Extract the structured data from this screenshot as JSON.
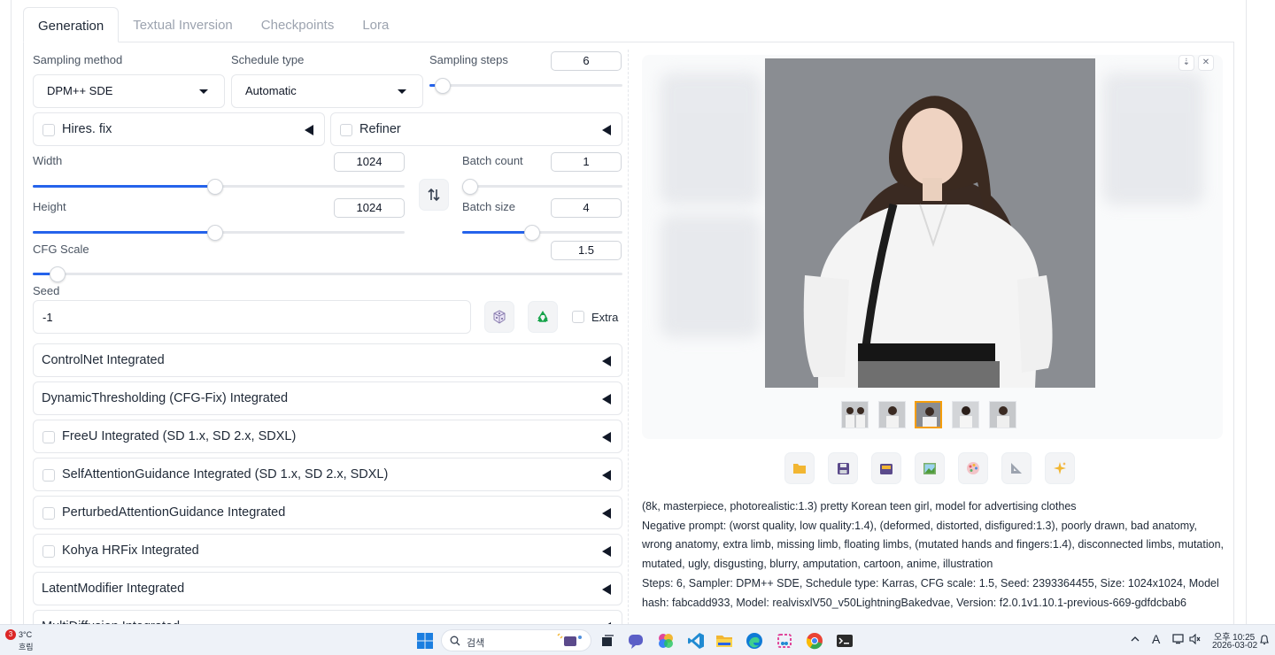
{
  "tabs": [
    "Generation",
    "Textual Inversion",
    "Checkpoints",
    "Lora"
  ],
  "sampling": {
    "method_label": "Sampling method",
    "method_value": "DPM++ SDE",
    "schedule_label": "Schedule type",
    "schedule_value": "Automatic",
    "steps_label": "Sampling steps",
    "steps_value": "6",
    "steps_fraction": 0.03
  },
  "hires": {
    "label": "Hires. fix"
  },
  "refiner": {
    "label": "Refiner"
  },
  "width": {
    "label": "Width",
    "value": "1024",
    "fraction": 0.49
  },
  "height": {
    "label": "Height",
    "value": "1024",
    "fraction": 0.49
  },
  "batch_count": {
    "label": "Batch count",
    "value": "1",
    "fraction": 0.0
  },
  "batch_size": {
    "label": "Batch size",
    "value": "4",
    "fraction": 0.43
  },
  "cfg": {
    "label": "CFG Scale",
    "value": "1.5",
    "fraction": 0.03
  },
  "seed": {
    "label": "Seed",
    "value": "-1",
    "extra_label": "Extra"
  },
  "accordions": [
    {
      "label": "ControlNet Integrated",
      "checkbox": false
    },
    {
      "label": "DynamicThresholding (CFG-Fix) Integrated",
      "checkbox": false
    },
    {
      "label": "FreeU Integrated (SD 1.x, SD 2.x, SDXL)",
      "checkbox": true
    },
    {
      "label": "SelfAttentionGuidance Integrated (SD 1.x, SD 2.x, SDXL)",
      "checkbox": true
    },
    {
      "label": "PerturbedAttentionGuidance Integrated",
      "checkbox": true
    },
    {
      "label": "Kohya HRFix Integrated",
      "checkbox": true
    },
    {
      "label": "LatentModifier Integrated",
      "checkbox": false
    },
    {
      "label": "MultiDiffusion Integrated",
      "checkbox": false
    }
  ],
  "gallery": {
    "download_glyph": "⇣",
    "close_glyph": "✕",
    "thumbnail_count": 5,
    "selected_thumbnail": 3
  },
  "toolbar_icons": [
    "folder-icon",
    "save-icon",
    "zip-icon",
    "image-icon",
    "palette-icon",
    "ruler-icon",
    "sparkle-icon"
  ],
  "info": {
    "prompt": "(8k, masterpiece, photorealistic:1.3) pretty Korean teen girl, model for advertising clothes",
    "negative": "Negative prompt: (worst quality, low quality:1.4), (deformed, distorted, disfigured:1.3), poorly drawn, bad anatomy, wrong anatomy, extra limb, missing limb, floating limbs, (mutated hands and fingers:1.4), disconnected limbs, mutation, mutated, ugly, disgusting, blurry, amputation, cartoon, anime, illustration",
    "params": "Steps: 6, Sampler: DPM++ SDE, Schedule type: Karras, CFG scale: 1.5, Seed: 2393364455, Size: 1024x1024, Model hash: fabcadd933, Model: realvisxlV50_v50LightningBakedvae, Version: f2.0.1v1.10.1-previous-669-gdfdcbab6"
  },
  "taskbar": {
    "weather_badge": "3",
    "weather_temp": "3°C",
    "weather_desc": "흐림",
    "search_placeholder": "검색",
    "ime": "A",
    "ampm_time": "오후 10:25",
    "date": "2026-03-02"
  },
  "colors": {
    "accent": "#2563eb",
    "selected_thumb": "#f59e0b"
  }
}
